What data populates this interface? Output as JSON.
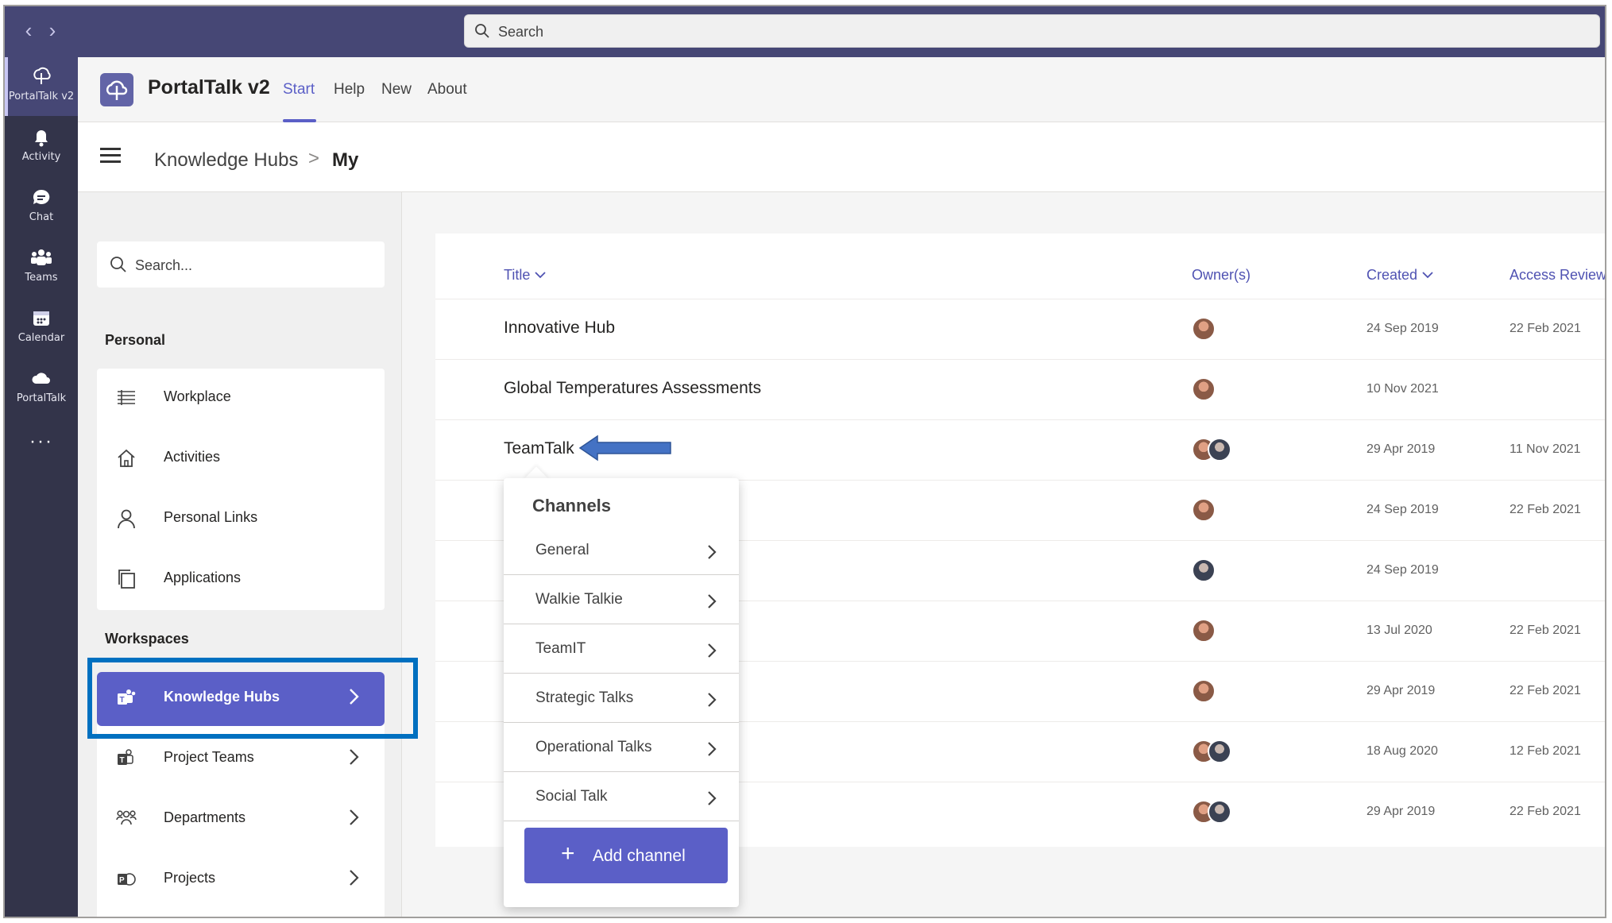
{
  "titlebar": {
    "search_placeholder": "Search"
  },
  "rail": {
    "items": [
      {
        "label": "PortalTalk v2",
        "icon": "portaltalk-icon"
      },
      {
        "label": "Activity",
        "icon": "bell-icon"
      },
      {
        "label": "Chat",
        "icon": "chat-icon"
      },
      {
        "label": "Teams",
        "icon": "teams-icon"
      },
      {
        "label": "Calendar",
        "icon": "calendar-icon"
      },
      {
        "label": "PortalTalk",
        "icon": "cloud-icon"
      }
    ],
    "more_label": "···"
  },
  "app": {
    "name": "PortalTalk v2",
    "tabs": [
      "Start",
      "Help",
      "New",
      "About"
    ],
    "active_tab": "Start"
  },
  "breadcrumb": {
    "root": "Knowledge Hubs",
    "separator": ">",
    "current": "My"
  },
  "leftpanel": {
    "search_placeholder": "Search...",
    "personal_heading": "Personal",
    "personal_items": [
      {
        "label": "Workplace",
        "icon": "list-icon"
      },
      {
        "label": "Activities",
        "icon": "home-icon"
      },
      {
        "label": "Personal Links",
        "icon": "person-icon"
      },
      {
        "label": "Applications",
        "icon": "copy-icon"
      }
    ],
    "workspaces_heading": "Workspaces",
    "workspace_items": [
      {
        "label": "Knowledge Hubs",
        "icon": "teams-icon",
        "selected": true
      },
      {
        "label": "Project Teams",
        "icon": "teams-icon"
      },
      {
        "label": "Departments",
        "icon": "org-icon"
      },
      {
        "label": "Projects",
        "icon": "project-icon"
      }
    ]
  },
  "table": {
    "columns": {
      "title": "Title",
      "owners": "Owner(s)",
      "created": "Created",
      "access_review": "Access Review"
    },
    "rows": [
      {
        "title": "Innovative Hub",
        "owners": 1,
        "created": "24 Sep 2019",
        "review": "22 Feb 2021"
      },
      {
        "title": "Global Temperatures Assessments",
        "owners": 1,
        "created": "10 Nov 2021",
        "review": ""
      },
      {
        "title": "TeamTalk",
        "owners": 2,
        "created": "29 Apr 2019",
        "review": "11 Nov 2021"
      },
      {
        "title": "",
        "owners": 1,
        "created": "24 Sep 2019",
        "review": "22 Feb 2021"
      },
      {
        "title": "",
        "owners": 1,
        "created": "24 Sep 2019",
        "review": ""
      },
      {
        "title": "",
        "owners": 1,
        "created": "13 Jul 2020",
        "review": "22 Feb 2021"
      },
      {
        "title": "",
        "owners": 1,
        "created": "29 Apr 2019",
        "review": "22 Feb 2021"
      },
      {
        "title": "",
        "owners": 2,
        "created": "18 Aug 2020",
        "review": "12 Feb 2021"
      },
      {
        "title": "",
        "owners": 2,
        "created": "29 Apr 2019",
        "review": "22 Feb 2021"
      }
    ]
  },
  "channels_popup": {
    "title": "Channels",
    "items": [
      "General",
      "Walkie Talkie",
      "TeamIT",
      "Strategic Talks",
      "Operational Talks",
      "Social Talk"
    ],
    "add_label": "Add channel"
  },
  "colors": {
    "accent": "#5b5fc7",
    "rail": "#33344a",
    "titlebar": "#464775",
    "highlight_box": "#0070c0",
    "arrow": "#4472c4"
  }
}
